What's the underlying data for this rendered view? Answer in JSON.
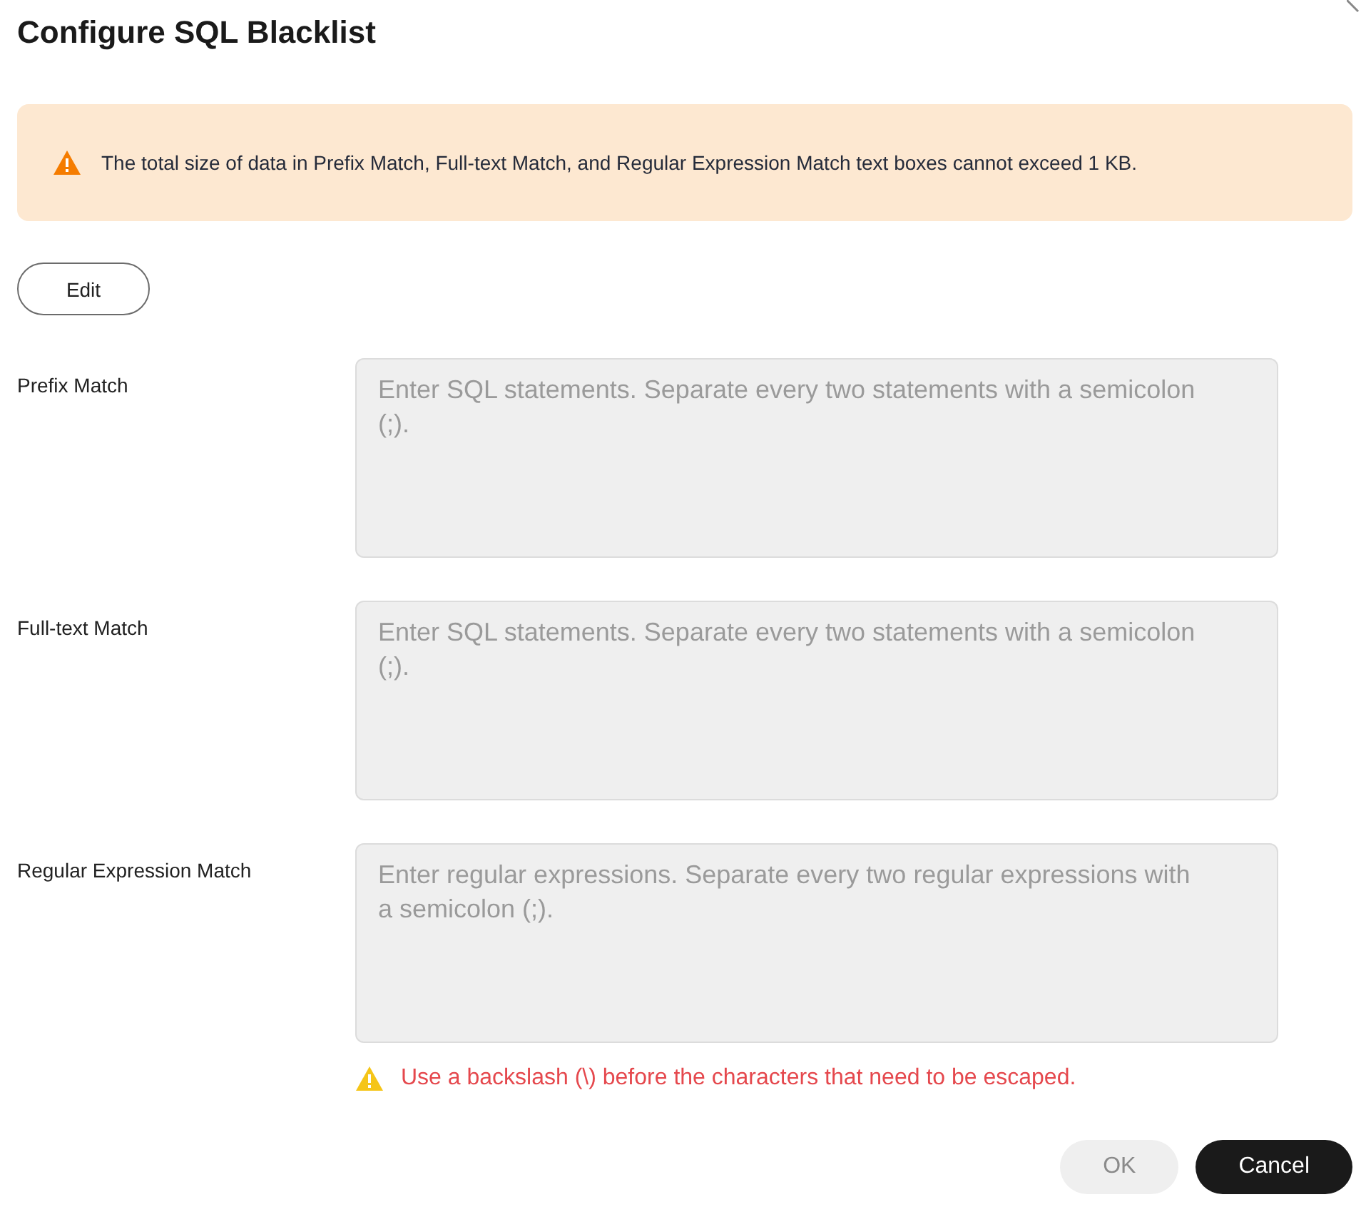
{
  "dialog": {
    "title": "Configure SQL Blacklist"
  },
  "alert": {
    "kind": "warning",
    "text": "The total size of data in Prefix Match, Full-text Match, and Regular Expression Match text boxes cannot exceed 1 KB."
  },
  "edit_button": {
    "label": "Edit"
  },
  "fields": [
    {
      "label": "Prefix Match",
      "placeholder": "Enter SQL statements. Separate every two statements with a semicolon (;).",
      "disabled": true
    },
    {
      "label": "Full-text Match",
      "placeholder": "Enter SQL statements. Separate every two statements with a semicolon (;).",
      "disabled": true
    },
    {
      "label": "Regular Expression Match",
      "placeholder": "Enter regular expressions. Separate every two regular expressions with a semicolon (;).",
      "disabled": true,
      "hint": "Use a backslash (\\) before the characters that need to be escaped."
    }
  ],
  "buttons": [
    {
      "label": "OK",
      "kind": "secondary",
      "disabled": true
    },
    {
      "label": "Cancel",
      "kind": "primary",
      "disabled": false
    }
  ]
}
